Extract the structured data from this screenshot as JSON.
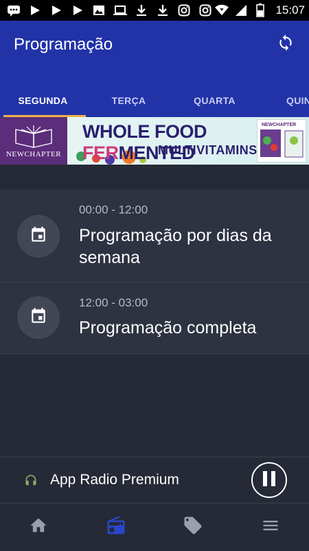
{
  "status_bar": {
    "time": "15:07",
    "left_icons": [
      "chat-icon",
      "play-icon",
      "play-icon",
      "play-icon",
      "image-icon",
      "laptop-icon",
      "download-icon",
      "download-icon",
      "instagram-icon",
      "instagram-icon"
    ],
    "right_icons": [
      "wifi-icon",
      "signal-icon",
      "battery-icon"
    ]
  },
  "app_bar": {
    "title": "Programação",
    "refresh_icon": "refresh-icon",
    "tabs": [
      {
        "label": "SEGUNDA",
        "active": true
      },
      {
        "label": "TERÇA",
        "active": false
      },
      {
        "label": "QUARTA",
        "active": false
      },
      {
        "label": "QUIN",
        "active": false
      }
    ]
  },
  "ad": {
    "brand": "NEWCHAPTER",
    "headline_part1": "WHOLE FOOD ",
    "headline_part2": "FER",
    "headline_part3": "MENTED",
    "subline": "MULTIVITAMINS",
    "product_label": "NEWCHAPTER"
  },
  "programs": [
    {
      "time": "00:00 - 12:00",
      "title": "Programação por dias da semana",
      "icon": "calendar-icon"
    },
    {
      "time": "12:00 - 03:00",
      "title": "Programação completa",
      "icon": "calendar-icon"
    }
  ],
  "player": {
    "name": "App Radio Premium",
    "headphones_icon": "headphones-icon",
    "pause_icon": "pause-icon"
  },
  "bottom_nav": {
    "items": [
      {
        "icon": "home-icon",
        "active": false
      },
      {
        "icon": "radio-icon",
        "active": true
      },
      {
        "icon": "tag-icon",
        "active": false
      },
      {
        "icon": "menu-icon",
        "active": false
      }
    ]
  },
  "colors": {
    "primary": "#2233a8",
    "accent_tab": "#f0b04a",
    "background": "#252a36",
    "card": "#2e3341",
    "nav_active": "#2a47c9",
    "nav_inactive": "#9aa0ab"
  }
}
